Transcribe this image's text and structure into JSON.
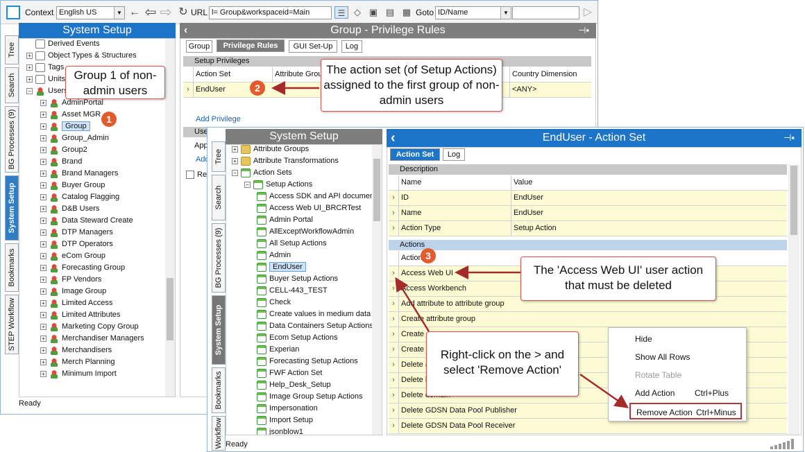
{
  "toolbar": {
    "context_label": "Context",
    "context_value": "English US",
    "url_label": "URL",
    "url_value": "l= Group&workspaceid=Main",
    "goto_label": "Goto",
    "goto_value": "ID/Name"
  },
  "left_tabs": [
    "Tree",
    "Search",
    "BG Processes (9)",
    "System Setup",
    "Bookmarks",
    "STEP Workflow"
  ],
  "system_setup_title": "System Setup",
  "tree1": [
    "Derived Events",
    "Object Types & Structures",
    "Tags",
    "Units",
    "Users",
    "AdminPortal",
    "Asset MGR",
    "Group",
    "Group_Admin",
    "Group2",
    "Brand",
    "Brand Managers",
    "Buyer Group",
    "Catalog Flagging",
    "D&B Users",
    "Data Steward Create",
    "DTP Managers",
    "DTP Operators",
    "eCom Group",
    "Forecasting Group",
    "FP Vendors",
    "Image Group",
    "Limited Access",
    "Limited Attributes",
    "Marketing Copy Group",
    "Merchandiser Managers",
    "Merchandisers",
    "Merch Planning",
    "Minimum Import"
  ],
  "status_ready": "Ready",
  "group_panel": {
    "title": "Group - Privilege Rules",
    "tabs": [
      "Group",
      "Privilege Rules",
      "GUI Set-Up",
      "Log"
    ],
    "setup_privileges": "Setup Privileges",
    "col_action_set": "Action Set",
    "col_attribute_group": "Attribute Group",
    "col_country": "Country Dimension",
    "row_action_set": "EndUser",
    "row_country": "<ANY>",
    "add_privilege": "Add Privilege",
    "section2_short": "Use",
    "app_short": "App",
    "add_short": "Add",
    "rea_short": "Rea"
  },
  "tree2_tabs": [
    "Tree",
    "Search",
    "BG Processes (9)",
    "System Setup",
    "Bookmarks",
    "Workflow"
  ],
  "tree2": [
    "Attribute Groups",
    "Attribute Transformations",
    "Action Sets",
    "Setup Actions",
    "Access SDK and API documentation",
    "Access Web UI_BRCRTest",
    "Admin Portal",
    "AllExceptWorkflowAdmin",
    "All Setup Actions",
    "Admin",
    "EndUser",
    "Buyer Setup Actions",
    "CELL-443_TEST",
    "Check",
    "Create values in medium data",
    "Data Containers Setup Actions",
    "Ecom Setup Actions",
    "Experian",
    "Forecasting Setup Actions",
    "FWF Action Set",
    "Help_Desk_Setup",
    "Image Group Setup Actions",
    "Impersonation",
    "Import Setup",
    "jsonblow1"
  ],
  "enduser_panel": {
    "title": "EndUser - Action Set",
    "tabs": [
      "Action Set",
      "Log"
    ],
    "description": "Description",
    "col_name": "Name",
    "col_value": "Value",
    "desc_rows": [
      {
        "name": "ID",
        "value": "EndUser"
      },
      {
        "name": "Name",
        "value": "EndUser"
      },
      {
        "name": "Action Type",
        "value": "Setup Action"
      }
    ],
    "actions": "Actions",
    "actions_col": "Action",
    "action_rows": [
      "Access Web UI",
      "Access Workbench",
      "Add attribute to attribute group",
      "Create attribute group",
      "Create c",
      "Create p",
      "Delete a",
      "Delete b",
      "Delete domain",
      "Delete GDSN Data Pool Publisher",
      "Delete GDSN Data Pool Receiver"
    ]
  },
  "context_menu": [
    {
      "label": "Hide",
      "shortcut": ""
    },
    {
      "label": "Show All Rows",
      "shortcut": ""
    },
    {
      "label": "Rotate Table",
      "shortcut": ""
    },
    {
      "label": "Add Action",
      "shortcut": "Ctrl+Plus"
    },
    {
      "label": "Remove Action",
      "shortcut": "Ctrl+Minus"
    }
  ],
  "callouts": {
    "c1": "Group 1 of non-admin users",
    "c2": "The action set (of Setup Actions) assigned to the first group of non-admin users",
    "c3": "The 'Access Web UI' user action that must be deleted",
    "c4": "Right-click on the > and select 'Remove Action'"
  },
  "badges": [
    "1",
    "2",
    "3"
  ],
  "colors": {
    "accent": "#1c75c8",
    "callout_border": "#d9534f",
    "badge": "#e35b2c",
    "row_yellow": "#fdfbd3"
  }
}
